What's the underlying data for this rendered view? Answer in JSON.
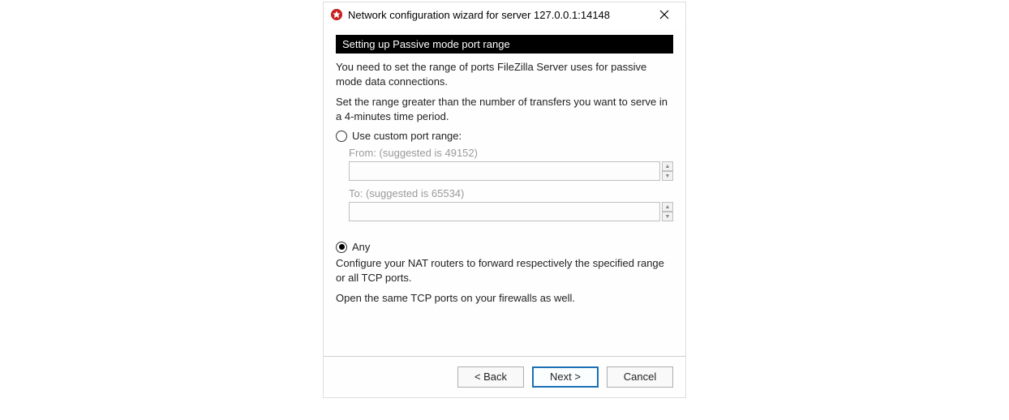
{
  "titlebar": {
    "title": "Network configuration wizard for server 127.0.0.1:14148"
  },
  "section": {
    "heading": "Setting up Passive mode port range"
  },
  "body": {
    "para1": "You need to set the range of ports FileZilla Server uses for passive mode data connections.",
    "para2": "Set the range greater than the number of transfers you want to serve in a 4-minutes time period.",
    "radio_custom_label": "Use custom port range:",
    "from_label": "From: (suggested is 49152)",
    "from_value": "",
    "to_label": "To: (suggested is 65534)",
    "to_value": "",
    "radio_any_label": "Any",
    "para3": "Configure your NAT routers to forward respectively the specified range or all TCP ports.",
    "para4": "Open the same TCP ports on your firewalls as well."
  },
  "footer": {
    "back_label": "< Back",
    "next_label": "Next >",
    "cancel_label": "Cancel"
  },
  "radio_state": {
    "custom_selected": false,
    "any_selected": true
  }
}
